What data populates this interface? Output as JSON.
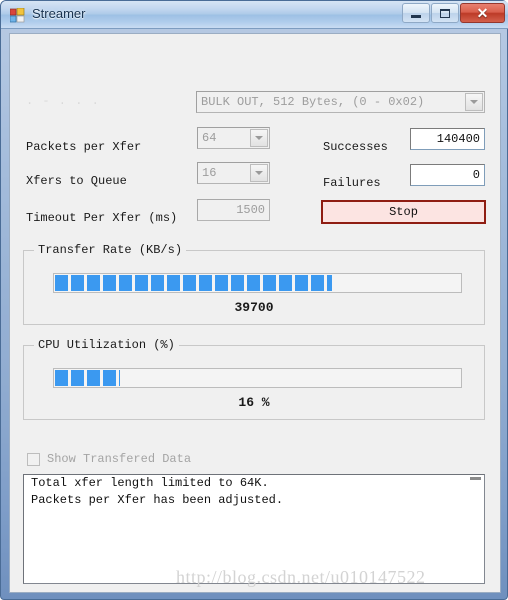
{
  "window": {
    "title": "Streamer",
    "icon": "app-squares-icon",
    "buttons": {
      "minimize": "minimize-icon",
      "maximize": "maximize-icon",
      "close": "✕"
    }
  },
  "endpoint": {
    "ghost_label": ".  -  .   .   .",
    "combo_value": "BULK OUT,    512 Bytes,    (0 - 0x02)"
  },
  "settings": {
    "packets_label": "Packets per Xfer",
    "packets_value": "64",
    "xfers_label": "Xfers to Queue",
    "xfers_value": "16",
    "timeout_label": "Timeout Per Xfer (ms)",
    "timeout_value": "1500"
  },
  "stats": {
    "successes_label": "Successes",
    "successes_value": "140400",
    "failures_label": "Failures",
    "failures_value": "0",
    "stop_label": "Stop",
    "stop_border_color": "#8f1d12",
    "stop_fill_color": "#fce4e2"
  },
  "transfer_rate": {
    "group_title": "Transfer Rate (KB/s)",
    "value": "39700",
    "percent": 68,
    "bar_color": "#3b99f0"
  },
  "cpu": {
    "group_title": "CPU Utilization (%)",
    "value": "16 %",
    "percent": 16,
    "bar_color": "#3b99f0"
  },
  "log": {
    "checkbox_label": "Show Transfered Data",
    "checkbox_checked": false,
    "lines": [
      "Total xfer length limited to 64K.",
      "Packets per Xfer has been adjusted."
    ]
  },
  "watermark": {
    "text": "http://blog.csdn.net/u010147522"
  }
}
